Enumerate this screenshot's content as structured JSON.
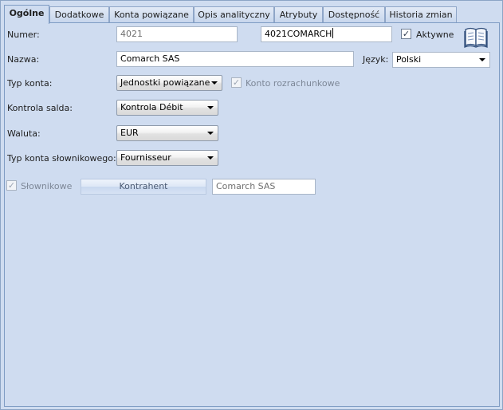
{
  "tabs": [
    {
      "label": "Ogólne",
      "active": true
    },
    {
      "label": "Dodatkowe"
    },
    {
      "label": "Konta powiązane"
    },
    {
      "label": "Opis analityczny"
    },
    {
      "label": "Atrybuty"
    },
    {
      "label": "Dostępność"
    },
    {
      "label": "Historia zmian"
    }
  ],
  "form": {
    "numer_label": "Numer:",
    "numer_value": "4021",
    "numer_full_value": "4021COMARCH",
    "aktywne_label": "Aktywne",
    "aktywne_checked": "✓",
    "nazwa_label": "Nazwa:",
    "nazwa_value": "Comarch SAS",
    "jezyk_label": "Język:",
    "jezyk_value": "Polski",
    "typ_konta_label": "Typ konta:",
    "typ_konta_value": "Jednostki powiązane",
    "konto_rozrachunkowe_label": "Konto rozrachunkowe",
    "konto_rozrachunkowe_checked": "✓",
    "kontrola_salda_label": "Kontrola salda:",
    "kontrola_salda_value": "Kontrola Débit",
    "waluta_label": "Waluta:",
    "waluta_value": "EUR",
    "typ_slownikowego_label": "Typ konta słownikowego:",
    "typ_slownikowego_value": "Fournisseur",
    "slownikowe_label": "Słownikowe",
    "slownikowe_checked": "✓",
    "kontrahent_button": "Kontrahent",
    "kontrahent_value": "Comarch SAS"
  },
  "icons": {
    "dictionary": "book-icon"
  },
  "colors": {
    "panel_bg": "#cfdcf0",
    "tab_border": "#7f9cc4"
  }
}
